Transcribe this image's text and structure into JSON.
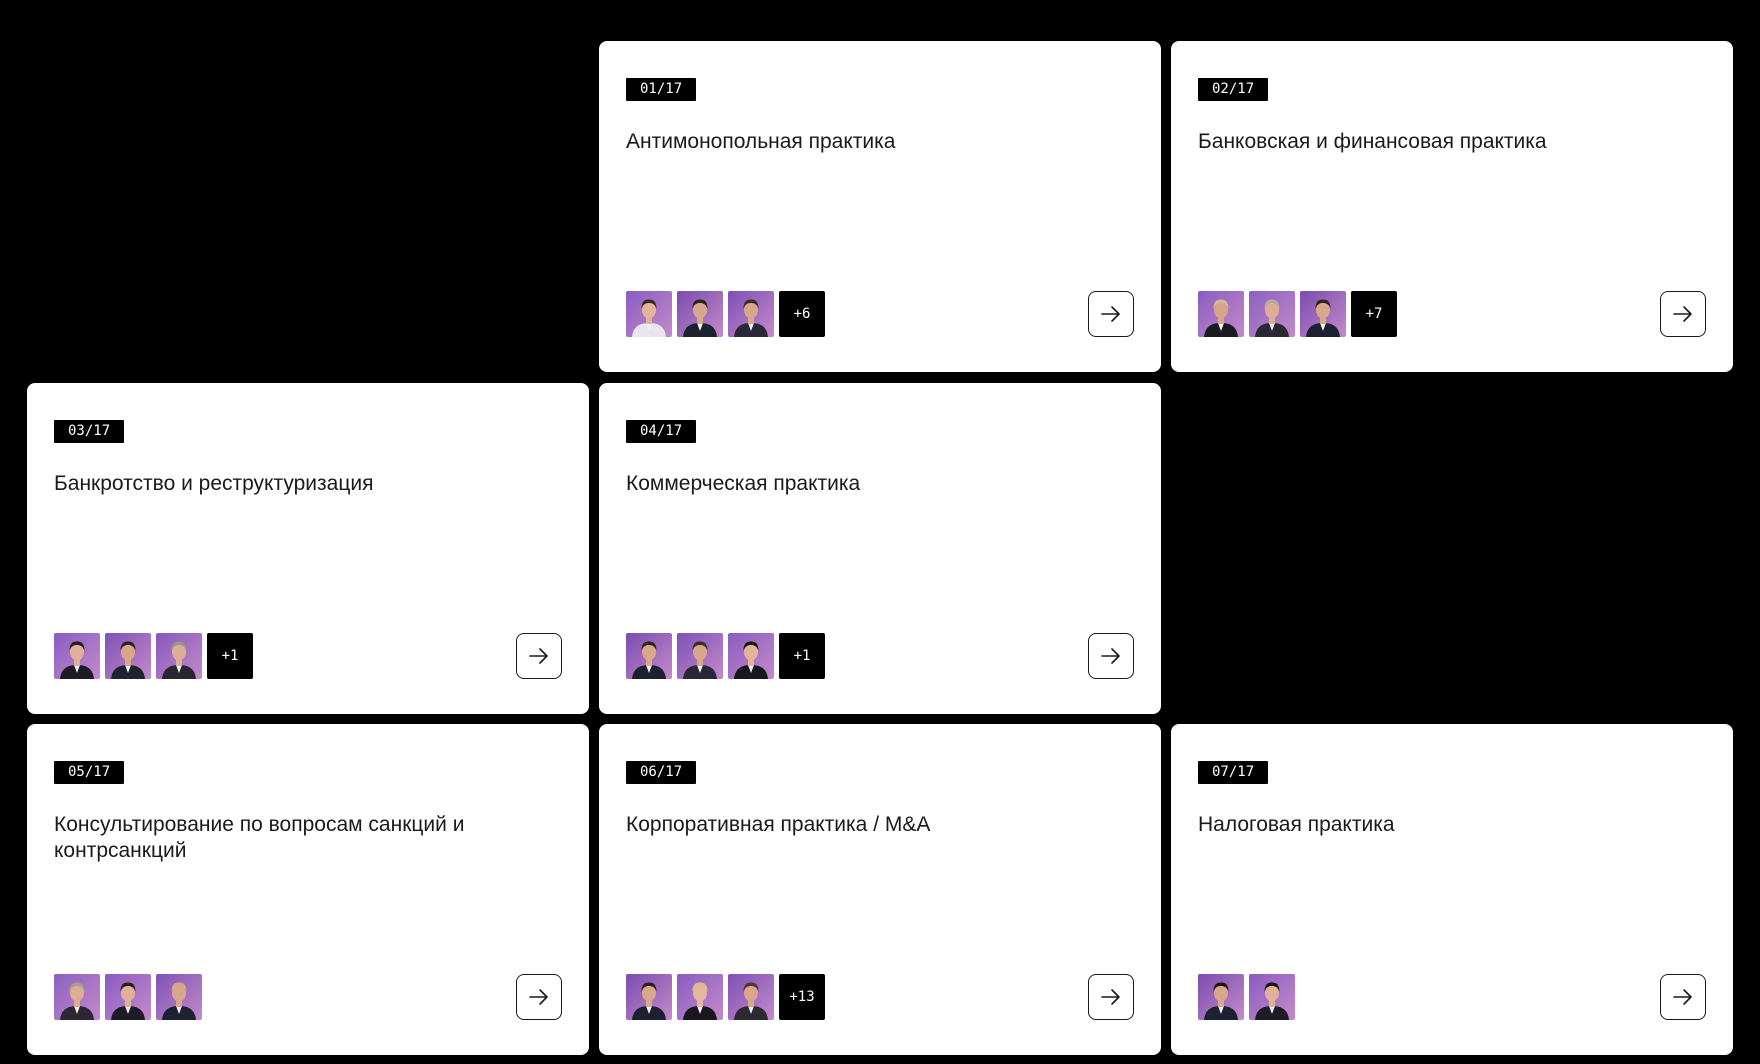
{
  "colors": {
    "page_background": "#000000",
    "card_background": "#ffffff",
    "tag_background": "#000000",
    "avatar_background": "#7b4fb3"
  },
  "practices": [
    {
      "index": "01/17",
      "title": "Антимонопольная практика",
      "team": [
        {
          "icon": "person-photo",
          "suit": "#e9e6ee",
          "skin": "#e2b49a",
          "hair": "#3b2a22",
          "bg": "#8a5cc2"
        },
        {
          "icon": "person-photo",
          "suit": "#1d2230",
          "skin": "#d9a88c",
          "hair": "#2b211c",
          "bg": "#7a4cb0"
        },
        {
          "icon": "person-photo",
          "suit": "#2a2838",
          "skin": "#d8a68a",
          "hair": "#3a2d25",
          "bg": "#7d50b6"
        }
      ],
      "more": "+6"
    },
    {
      "index": "02/17",
      "title": "Банковская и финансовая практика",
      "team": [
        {
          "icon": "person-photo",
          "suit": "#1a1b22",
          "skin": "#d6a68b",
          "hair": "#d8b49a",
          "bg": "#8a5cc2"
        },
        {
          "icon": "person-photo",
          "suit": "#2b2734",
          "skin": "#dcae93",
          "hair": "#b8aaa0",
          "bg": "#8b60c0"
        },
        {
          "icon": "person-photo",
          "suit": "#1c2030",
          "skin": "#d8a88c",
          "hair": "#2e231d",
          "bg": "#7a4cb0"
        }
      ],
      "more": "+7"
    },
    {
      "index": "03/17",
      "title": "Банкротство и реструктуризация",
      "team": [
        {
          "icon": "person-photo",
          "suit": "#1e1a26",
          "skin": "#e0b19a",
          "hair": "#2a1c18",
          "bg": "#8a5cc2"
        },
        {
          "icon": "person-photo",
          "suit": "#1f2230",
          "skin": "#d9a688",
          "hair": "#2a201a",
          "bg": "#7e52b6"
        },
        {
          "icon": "person-photo",
          "suit": "#2a2533",
          "skin": "#dcae93",
          "hair": "#9f948c",
          "bg": "#8558bd"
        }
      ],
      "more": "+1"
    },
    {
      "index": "04/17",
      "title": "Коммерческая практика",
      "team": [
        {
          "icon": "person-photo",
          "suit": "#1c2030",
          "skin": "#d8a88c",
          "hair": "#2e231d",
          "bg": "#7a4cb0"
        },
        {
          "icon": "person-photo",
          "suit": "#2a2838",
          "skin": "#d8a68a",
          "hair": "#3a2d25",
          "bg": "#7d50b6"
        },
        {
          "icon": "person-photo",
          "suit": "#1a1620",
          "skin": "#e2b49a",
          "hair": "#1a1412",
          "bg": "#8a5cc2"
        }
      ],
      "more": "+1"
    },
    {
      "index": "05/17",
      "title": "Консультирование по вопросам санкций и контрсанкций",
      "team": [
        {
          "icon": "person-photo",
          "suit": "#2b2734",
          "skin": "#dcae93",
          "hair": "#a89c94",
          "bg": "#8b60c0"
        },
        {
          "icon": "person-photo",
          "suit": "#1e1a26",
          "skin": "#e0b19a",
          "hair": "#2a1c18",
          "bg": "#8a5cc2"
        },
        {
          "icon": "person-photo",
          "suit": "#1d2230",
          "skin": "#d9a88c",
          "hair": "#cfa889",
          "bg": "#7e52b6"
        }
      ],
      "more": ""
    },
    {
      "index": "06/17",
      "title": "Корпоративная практика / M&A",
      "team": [
        {
          "icon": "person-photo",
          "suit": "#1c2030",
          "skin": "#d8a88c",
          "hair": "#2a211c",
          "bg": "#7a4cb0"
        },
        {
          "icon": "person-photo",
          "suit": "#1a1620",
          "skin": "#e4b89e",
          "hair": "#d9c08a",
          "bg": "#8a5cc2"
        },
        {
          "icon": "person-photo",
          "suit": "#2a2a30",
          "skin": "#d8a68a",
          "hair": "#4a3a30",
          "bg": "#7d50b6"
        }
      ],
      "more": "+13"
    },
    {
      "index": "07/17",
      "title": "Налоговая практика",
      "team": [
        {
          "icon": "person-photo",
          "suit": "#1c2030",
          "skin": "#d8a88c",
          "hair": "#1e1814",
          "bg": "#7a4cb0"
        },
        {
          "icon": "person-photo",
          "suit": "#1e1a26",
          "skin": "#e0b19a",
          "hair": "#1a1412",
          "bg": "#8a5cc2"
        }
      ],
      "more": ""
    }
  ],
  "arrow_icon": "arrow-right-icon"
}
